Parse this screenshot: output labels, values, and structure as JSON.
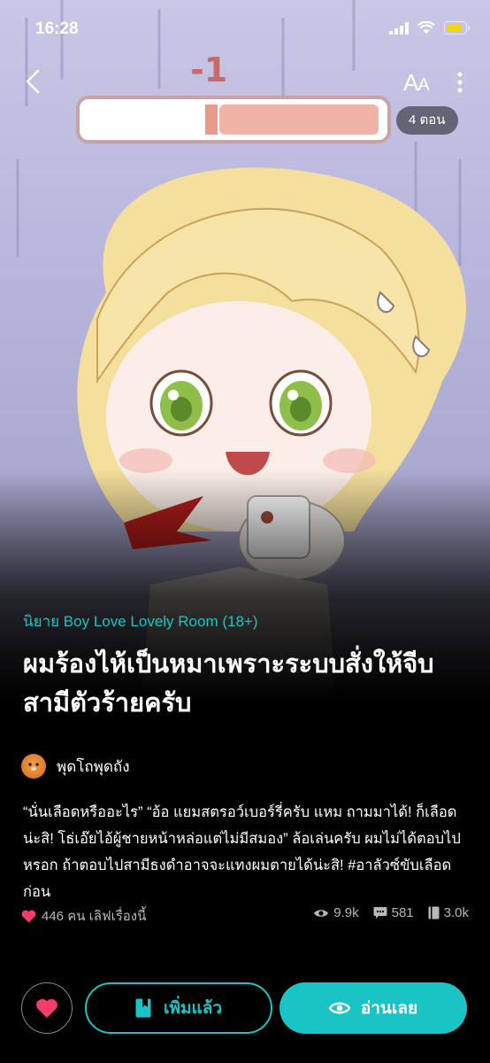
{
  "status_bar": {
    "time": "16:28"
  },
  "cover": {
    "episode_count": "4 ตอน"
  },
  "nav": {
    "font_size_label_big": "A",
    "font_size_label_small": "A"
  },
  "story": {
    "category": "นิยาย Boy Love Lovely Room (18+)",
    "title": "ผมร้องไห้เป็นหมาเพราะระบบสั่งให้จีบสามีตัวร้ายครับ",
    "author": "พุดโถพุดถัง",
    "description": "“นั่นเลือดหรืออะไร” “อ้อ แยมสตรอว์เบอร์รี่ครับ แหม ถามมาได้! ก็เลือดน่ะสิ! โธ่เอ๊ยไอ้ผู้ชายหน้าหล่อแต่ไม่มีสมอง” ล้อเล่นครับ ผมไม่ได้ตอบไปหรอก ถ้าตอบไปสามีธงดำอาจจะแทงผมตายได้น่ะสิ! #อาลัวซ์ขับเลือดก่อน"
  },
  "stats": {
    "likes": "446 คน เลิฟเรื่องนี้",
    "views": "9.9k",
    "comments": "581",
    "chapters": "3.0k"
  },
  "actions": {
    "add_label": "เพิ่มแล้ว",
    "read_label": "อ่านเลย"
  },
  "colors": {
    "accent": "#1bc4c4",
    "heart": "#f23c6b"
  }
}
